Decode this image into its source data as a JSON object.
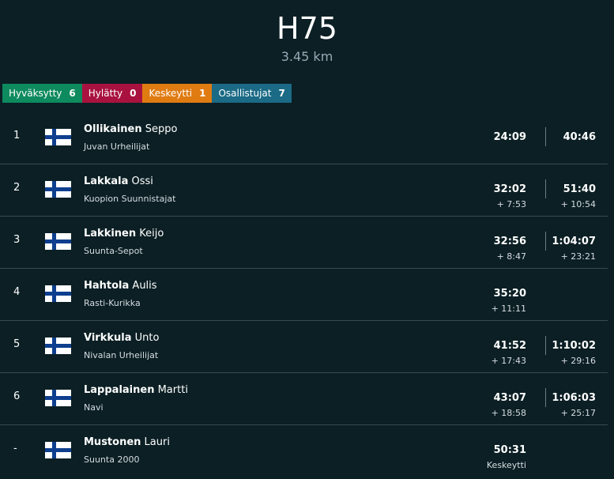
{
  "header": {
    "title": "H75",
    "subtitle": "3.45 km"
  },
  "stats": [
    {
      "label": "Hyväksytty",
      "count": "6",
      "color": "#0e8a5f"
    },
    {
      "label": "Hylätty",
      "count": "0",
      "color": "#a9123f"
    },
    {
      "label": "Keskeytti",
      "count": "1",
      "color": "#e07b12"
    },
    {
      "label": "Osallistujat",
      "count": "7",
      "color": "#1b6a86"
    }
  ],
  "results": [
    {
      "rank": "1",
      "last": "Ollikainen",
      "first": "Seppo",
      "club": "Juvan Urheilijat",
      "time": "24:09",
      "diff": "",
      "time2": "40:46",
      "diff2": "",
      "flag": "finland-flag-icon"
    },
    {
      "rank": "2",
      "last": "Lakkala",
      "first": "Ossi",
      "club": "Kuopion Suunnistajat",
      "time": "32:02",
      "diff": "+ 7:53",
      "time2": "51:40",
      "diff2": "+ 10:54",
      "flag": "finland-flag-icon"
    },
    {
      "rank": "3",
      "last": "Lakkinen",
      "first": "Keijo",
      "club": "Suunta-Sepot",
      "time": "32:56",
      "diff": "+ 8:47",
      "time2": "1:04:07",
      "diff2": "+ 23:21",
      "flag": "finland-flag-icon"
    },
    {
      "rank": "4",
      "last": "Hahtola",
      "first": "Aulis",
      "club": "Rasti-Kurikka",
      "time": "35:20",
      "diff": "+ 11:11",
      "time2": "",
      "diff2": "",
      "flag": "finland-flag-icon"
    },
    {
      "rank": "5",
      "last": "Virkkula",
      "first": "Unto",
      "club": "Nivalan Urheilijat",
      "time": "41:52",
      "diff": "+ 17:43",
      "time2": "1:10:02",
      "diff2": "+ 29:16",
      "flag": "finland-flag-icon"
    },
    {
      "rank": "6",
      "last": "Lappalainen",
      "first": "Martti",
      "club": "Navi",
      "time": "43:07",
      "diff": "+ 18:58",
      "time2": "1:06:03",
      "diff2": "+ 25:17",
      "flag": "finland-flag-icon"
    },
    {
      "rank": "-",
      "last": "Mustonen",
      "first": "Lauri",
      "club": "Suunta 2000",
      "time": "50:31",
      "diff": "Keskeytti",
      "time2": "",
      "diff2": "",
      "flag": "finland-flag-icon"
    }
  ]
}
